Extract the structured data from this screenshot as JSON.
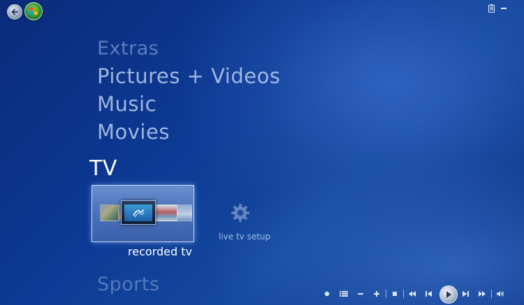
{
  "menu": {
    "extras": "Extras",
    "pictures_videos": "Pictures + Videos",
    "music": "Music",
    "movies": "Movies",
    "tv": "TV",
    "sports": "Sports"
  },
  "tv_strip": {
    "recorded_tv": "recorded tv",
    "live_tv_setup": "live tv setup"
  },
  "icons": {
    "back": "back-arrow-icon",
    "start": "windows-start-orb-icon",
    "battery": "battery-icon",
    "minimize": "minimize-icon",
    "gear": "gear-icon",
    "transport": [
      "record-icon",
      "list-icon",
      "minus-icon",
      "plus-icon",
      "stop-icon",
      "rewind-icon",
      "skip-back-icon",
      "play-icon",
      "skip-forward-icon",
      "fast-forward-icon",
      "volume-icon"
    ]
  },
  "colors": {
    "background": "#0d3a95",
    "accent": "#5f86cc",
    "text": "#ffffff"
  }
}
